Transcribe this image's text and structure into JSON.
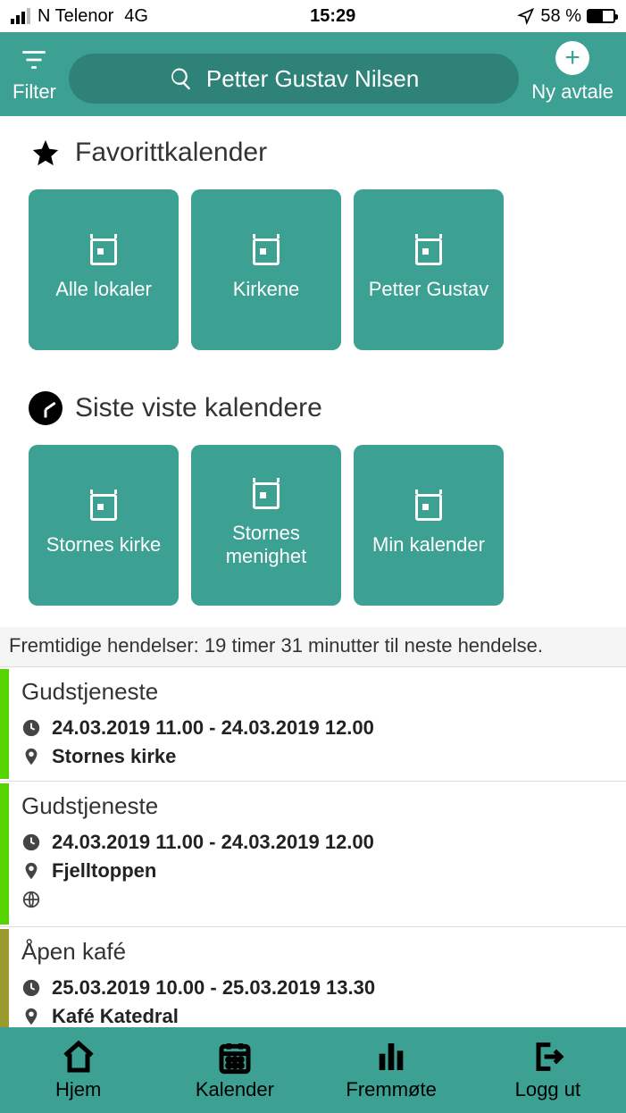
{
  "status": {
    "carrier": "N Telenor",
    "network": "4G",
    "time": "15:29",
    "battery_pct": "58 %"
  },
  "header": {
    "filter": "Filter",
    "search": "Petter Gustav  Nilsen",
    "new": "Ny avtale"
  },
  "sections": {
    "fav": {
      "title": "Favorittkalender",
      "tiles": [
        "Alle lokaler",
        "Kirkene",
        "Petter Gustav"
      ]
    },
    "recent": {
      "title": "Siste viste kalendere",
      "tiles": [
        "Stornes kirke",
        "Stornes menighet",
        "Min kalender"
      ]
    }
  },
  "upcoming_label": "Fremtidige hendelser: 19 timer 31 minutter til neste hendelse.",
  "events": [
    {
      "title": "Gudstjeneste",
      "time": "24.03.2019 11.00 - 24.03.2019 12.00",
      "place": "Stornes kirke",
      "bar": "green",
      "globe": false
    },
    {
      "title": "Gudstjeneste",
      "time": "24.03.2019 11.00 - 24.03.2019 12.00",
      "place": "Fjelltoppen",
      "bar": "green",
      "globe": true
    },
    {
      "title": "Åpen kafé",
      "time": "25.03.2019 10.00 - 25.03.2019 13.30",
      "place": "Kafé Katedral",
      "bar": "olive",
      "globe": false
    }
  ],
  "nav": {
    "home": "Hjem",
    "calendar": "Kalender",
    "attend": "Fremmøte",
    "logout": "Logg ut"
  }
}
